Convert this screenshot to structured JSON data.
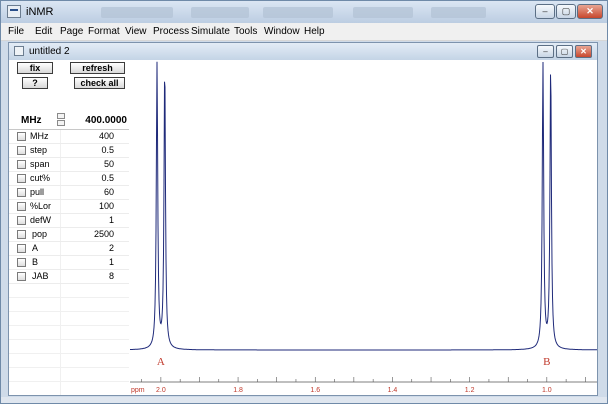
{
  "app": {
    "title": "iNMR"
  },
  "window_controls": {
    "minimize": "–",
    "maximize": "▢",
    "close": "✕"
  },
  "menu": [
    "File",
    "Edit",
    "Page",
    "Format",
    "View",
    "Process",
    "Simulate",
    "Tools",
    "Window",
    "Help"
  ],
  "document": {
    "title": "untitled 2",
    "controls": {
      "minimize": "–",
      "maximize": "▢",
      "close": "✕"
    }
  },
  "panel": {
    "fix_label": "fix",
    "refresh_label": "refresh",
    "help_label": "?",
    "check_all_label": "check all",
    "mhz_label": "MHz",
    "mhz_value": "400.0000",
    "params": [
      {
        "name": "MHz",
        "value": "400"
      },
      {
        "name": "step",
        "value": "0.5"
      },
      {
        "name": "span",
        "value": "50"
      },
      {
        "name": "cut%",
        "value": "0.5"
      },
      {
        "name": "pull",
        "value": "60"
      },
      {
        "name": "%Lor",
        "value": "100"
      },
      {
        "name": "defW",
        "value": "1"
      },
      {
        "name": "pop",
        "value": "2500"
      },
      {
        "name": "A",
        "value": "2"
      },
      {
        "name": "B",
        "value": "1"
      },
      {
        "name": "JAB",
        "value": "8"
      }
    ]
  },
  "chart_data": {
    "type": "line",
    "xlabel": "ppm",
    "xlim": [
      2.08,
      0.87
    ],
    "ticks": [
      2.0,
      1.8,
      1.6,
      1.4,
      1.2,
      1.0
    ],
    "tick_labels": [
      "2.0",
      "1.8",
      "1.6",
      "1.4",
      "1.2",
      "1.0"
    ],
    "peaks": [
      {
        "label": "A",
        "center": 2.0,
        "lines": [
          2.01,
          1.99
        ]
      },
      {
        "label": "B",
        "center": 1.0,
        "lines": [
          1.01,
          0.99
        ]
      }
    ],
    "line_color": "#1f2a7a",
    "tick_color": "#c0392b"
  }
}
